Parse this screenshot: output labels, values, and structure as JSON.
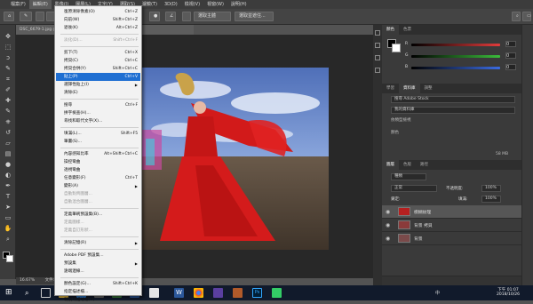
{
  "menubar": [
    "檔案(F)",
    "編輯(E)",
    "影像(I)",
    "圖層(L)",
    "文字(Y)",
    "選取(S)",
    "濾鏡(T)",
    "3D(D)",
    "檢視(V)",
    "視窗(W)",
    "說明(H)"
  ],
  "active_menu": "編輯(E)",
  "options": {
    "mask_btn": "選取並遮住...",
    "sample_btn": "選取主體"
  },
  "doc_tab": "DSC_6679-1.jpg @ 16.7% (圖層 1, RGB/8)",
  "status": {
    "zoom": "16.67%",
    "doc": "文件: 68.7M/137.4M"
  },
  "edit_menu": [
    {
      "label": "復原清除像素(O)",
      "shortcut": "Ctrl+Z"
    },
    {
      "label": "向前(W)",
      "shortcut": "Shift+Ctrl+Z"
    },
    {
      "label": "退後(K)",
      "shortcut": "Alt+Ctrl+Z"
    },
    {
      "sep": true
    },
    {
      "label": "淡化(D)...",
      "shortcut": "Shift+Ctrl+F",
      "disabled": true
    },
    {
      "sep": true
    },
    {
      "label": "剪下(T)",
      "shortcut": "Ctrl+X"
    },
    {
      "label": "拷貝(C)",
      "shortcut": "Ctrl+C"
    },
    {
      "label": "拷貝合併(Y)",
      "shortcut": "Shift+Ctrl+C"
    },
    {
      "label": "貼上(P)",
      "shortcut": "Ctrl+V",
      "highlight": true
    },
    {
      "label": "選擇性貼上(I)",
      "submenu": true
    },
    {
      "label": "清除(E)"
    },
    {
      "sep": true
    },
    {
      "label": "搜尋",
      "shortcut": "Ctrl+F"
    },
    {
      "label": "拼字檢查(H)..."
    },
    {
      "label": "尋找和取代文字(X)..."
    },
    {
      "sep": true
    },
    {
      "label": "填滿(L)...",
      "shortcut": "Shift+F5"
    },
    {
      "label": "筆畫(S)..."
    },
    {
      "sep": true
    },
    {
      "label": "內容感知比率",
      "shortcut": "Alt+Shift+Ctrl+C"
    },
    {
      "label": "操控彎曲"
    },
    {
      "label": "透視彎曲"
    },
    {
      "label": "任意變形(F)",
      "shortcut": "Ctrl+T"
    },
    {
      "label": "變形(A)",
      "submenu": true
    },
    {
      "label": "自動對齊圖層...",
      "disabled": true
    },
    {
      "label": "自動混合圖層...",
      "disabled": true
    },
    {
      "sep": true
    },
    {
      "label": "定義筆刷預設集(B)..."
    },
    {
      "label": "定義圖樣...",
      "disabled": true
    },
    {
      "label": "定義自訂形狀...",
      "disabled": true
    },
    {
      "sep": true
    },
    {
      "label": "清除記憶(R)",
      "submenu": true
    },
    {
      "sep": true
    },
    {
      "label": "Adobe PDF 預設集..."
    },
    {
      "label": "預設集",
      "submenu": true
    },
    {
      "label": "遠端連線..."
    },
    {
      "sep": true
    },
    {
      "label": "顏色設定(G)...",
      "shortcut": "Shift+Ctrl+K"
    },
    {
      "label": "指定描述檔..."
    },
    {
      "label": "轉換為描述檔(V)..."
    }
  ],
  "color_panel": {
    "tabs": [
      "顏色",
      "色票"
    ],
    "r": "0",
    "g": "0",
    "b": "0"
  },
  "lib_panel": {
    "tabs": [
      "學習",
      "資料庫",
      "調整"
    ],
    "search_placeholder": "搜尋 Adobe Stock",
    "lib_name": "我的資料庫",
    "view": "依類型檢視",
    "section": "顏色",
    "size": "58 MB"
  },
  "layers_panel": {
    "tabs": [
      "圖層",
      "色版",
      "路徑"
    ],
    "kind": "種類",
    "blend": "正常",
    "opacity_label": "不透明度:",
    "opacity": "100%",
    "lock_label": "鎖定:",
    "fill_label": "填滿:",
    "fill": "100%",
    "layers": [
      {
        "name": "模糊紋理",
        "selected": true
      },
      {
        "name": "背景 拷貝",
        "selected": false
      },
      {
        "name": "背景",
        "selected": false
      }
    ]
  },
  "taskbar": {
    "time": "下午 01:07",
    "date": "2018/10/26",
    "lang": "中"
  },
  "colors": {
    "highlight": "#1f6fd2",
    "red": "#e23b3b",
    "green": "#3bbd3b",
    "blue": "#3b6be2"
  }
}
